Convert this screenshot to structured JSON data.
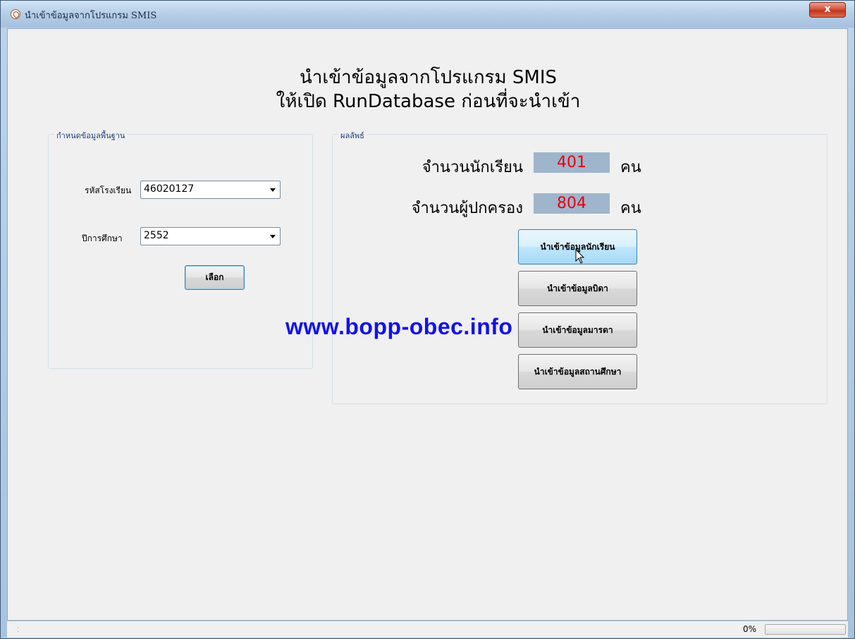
{
  "window": {
    "title": "นำเข้าข้อมูลจากโปรแกรม SMIS",
    "close_symbol": "x"
  },
  "header": {
    "line1": "นำเข้าข้อมูลจากโปรแกรม SMIS",
    "line2": "ให้เปิด RunDatabase ก่อนที่จะนำเข้า"
  },
  "settings_group": {
    "title": "กำหนดข้อมูลพื้นฐาน",
    "school_code_label": "รหัสโรงเรียน",
    "school_code_value": "46020127",
    "year_label": "ปีการศึกษา",
    "year_value": "2552",
    "select_button": "เลือก"
  },
  "results_group": {
    "title": "ผลลัพธ์",
    "students_label": "จำนวนนักเรียน",
    "students_count": "401",
    "students_unit": "คน",
    "parents_label": "จำนวนผู้ปกครอง",
    "parents_count": "804",
    "parents_unit": "คน",
    "buttons": {
      "import_students": "นำเข้าข้อมูลนักเรียน",
      "import_father": "นำเข้าข้อมูลบิดา",
      "import_mother": "นำเข้าข้อมูลมารดา",
      "import_school": "นำเข้าข้อมูลสถานศึกษา"
    }
  },
  "watermark": "www.bopp-obec.info",
  "statusbar": {
    "progress_text": "0%",
    "progress_value": 0
  }
}
